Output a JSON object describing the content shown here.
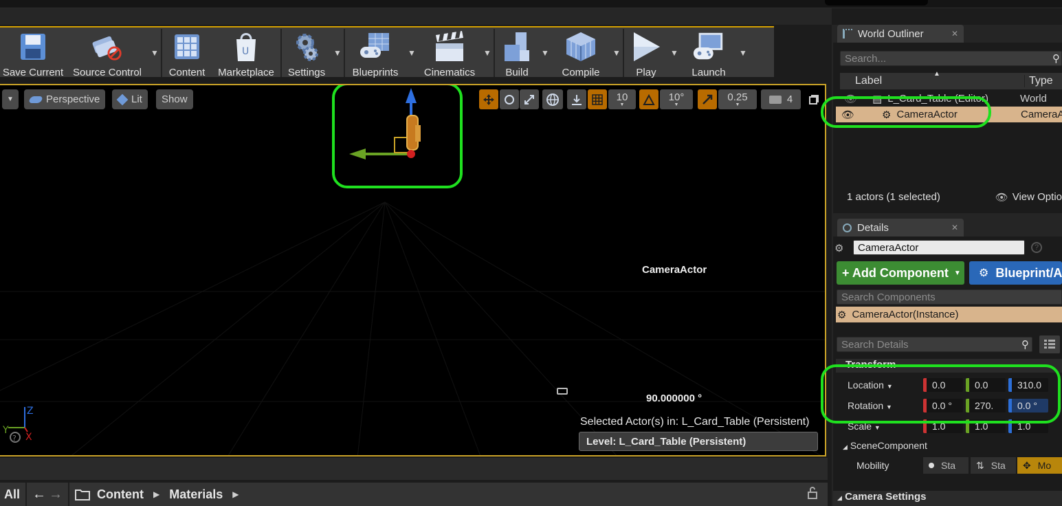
{
  "toolbar": {
    "buttons": [
      {
        "label": "Save Current",
        "icon": "floppy-disk-icon"
      },
      {
        "label": "Source Control",
        "icon": "source-control-icon"
      },
      {
        "label": "Content",
        "icon": "content-grid-icon"
      },
      {
        "label": "Marketplace",
        "icon": "marketplace-bag-icon"
      },
      {
        "label": "Settings",
        "icon": "gears-icon"
      },
      {
        "label": "Blueprints",
        "icon": "blueprints-icon"
      },
      {
        "label": "Cinematics",
        "icon": "clapperboard-icon"
      },
      {
        "label": "Build",
        "icon": "build-blocks-icon"
      },
      {
        "label": "Compile",
        "icon": "compile-cube-icon"
      },
      {
        "label": "Play",
        "icon": "play-icon"
      },
      {
        "label": "Launch",
        "icon": "launch-icon"
      }
    ]
  },
  "viewport": {
    "perspective_label": "Perspective",
    "lit_label": "Lit",
    "show_label": "Show",
    "grid_snap": "10",
    "rotation_snap": "10°",
    "scale_snap": "0.25",
    "camera_speed": "4",
    "camera_label": "CameraActor",
    "angle_readout": "90.000000 °",
    "selected_actors": "Selected Actor(s) in:  L_Card_Table (Persistent)",
    "level": "Level:  L_Card_Table (Persistent)"
  },
  "content_browser": {
    "all_label": "All",
    "crumb_content": "Content",
    "crumb_materials": "Materials"
  },
  "world_outliner": {
    "tab_title": "World Outliner",
    "search_placeholder": "Search...",
    "col_label": "Label",
    "col_type": "Type",
    "rows": [
      {
        "label": "L_Card_Table (Editor)",
        "type": "World"
      },
      {
        "label": "CameraActor",
        "type": "CameraA"
      }
    ],
    "status": "1 actors (1 selected)",
    "view_options": "View Optio"
  },
  "details": {
    "tab_title": "Details",
    "actor_name": "CameraActor",
    "add_component": "+ Add Component",
    "blueprint_button": "Blueprint/A",
    "search_components": "Search Components",
    "instance_row": "CameraActor(Instance)",
    "search_details": "Search Details",
    "transform_section": "Transform",
    "location_label": "Location",
    "location": [
      "0.0",
      "0.0",
      "310.0"
    ],
    "rotation_label": "Rotation",
    "rotation": [
      "0.0 °",
      "270.",
      "0.0 °"
    ],
    "scale_label": "Scale",
    "scale": [
      "1.0",
      "1.0",
      "1.0"
    ],
    "scene_component_section": "SceneComponent",
    "mobility_label": "Mobility",
    "mobility_options": [
      "Sta",
      "Sta",
      "Mo"
    ],
    "camera_settings_section": "Camera Settings"
  },
  "colors": {
    "accent_gold": "#c9a227",
    "highlight_green": "#1fe01f",
    "selected_row": "#d8b48c",
    "add_component_green": "#3c8c33",
    "blueprint_blue": "#2a68b8"
  }
}
